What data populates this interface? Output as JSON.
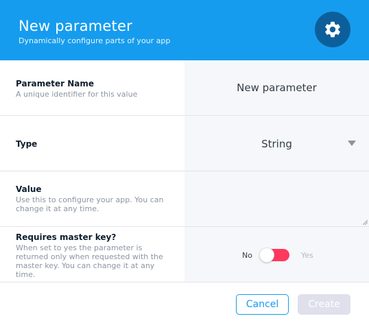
{
  "header": {
    "title": "New parameter",
    "subtitle": "Dynamically configure parts of your app",
    "icon": "gear-icon",
    "background": "#169cee",
    "icon_badge_color": "#0d5f9b"
  },
  "fields": {
    "name": {
      "label": "Parameter Name",
      "description": "A unique identifier for this value",
      "value": "New parameter"
    },
    "type": {
      "label": "Type",
      "selected": "String"
    },
    "value": {
      "label": "Value",
      "description": "Use this to configure your app. You can change it at any time.",
      "input_value": ""
    },
    "master_key": {
      "label": "Requires master key?",
      "description": "When set to yes the parameter is returned only when requested with the master key. You can change it at any time.",
      "off_label": "No",
      "on_label": "Yes",
      "toggle_color": "#ff395e"
    }
  },
  "footer": {
    "cancel_label": "Cancel",
    "create_label": "Create",
    "accent": "#169cee"
  }
}
